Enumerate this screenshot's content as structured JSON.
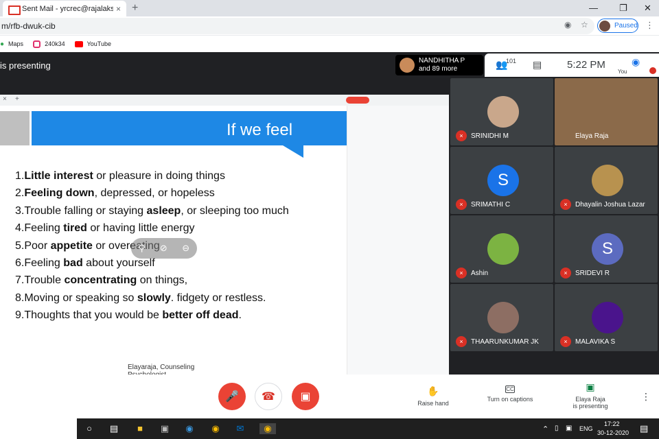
{
  "browser": {
    "tab_title": "Sent Mail - yrcrec@rajalakshmi.e",
    "tab_close": "×",
    "new_tab": "+",
    "url": "m/rfb-dwuk-cib",
    "profile_status": "Paused",
    "bookmarks": [
      {
        "label": "Maps",
        "icon": "maps-icon",
        "color": "#34a853"
      },
      {
        "label": "240k34",
        "icon": "instagram-icon",
        "color": "#e1306c"
      },
      {
        "label": "YouTube",
        "icon": "youtube-icon",
        "color": "#ff0000"
      }
    ]
  },
  "meet": {
    "presenting_text": "is presenting",
    "presenter_chip": {
      "name": "NANDHITHA P",
      "more": "and 89 more"
    },
    "participants_count": "101",
    "clock": "5:22  PM",
    "you_label": "You"
  },
  "slide": {
    "title": "If we feel",
    "items": [
      {
        "num": "1.",
        "bold": "Little interest",
        "rest": " or pleasure in doing things"
      },
      {
        "num": "2.",
        "bold": "Feeling down",
        "rest": ", depressed, or hopeless"
      },
      {
        "num": "3.",
        "pre": "Trouble falling or staying ",
        "bold": "asleep",
        "rest": ", or sleeping too much"
      },
      {
        "num": "4.",
        "pre": "Feeling ",
        "bold": "tired",
        "rest": " or having little energy"
      },
      {
        "num": "5.",
        "pre": "Poor ",
        "bold": "appetite",
        "rest": " or overeating"
      },
      {
        "num": "6.",
        "pre": "Feeling ",
        "bold": "bad",
        "rest": " about yourself"
      },
      {
        "num": "7.",
        "pre": "Trouble ",
        "bold": "concentrating",
        "rest": " on things,"
      },
      {
        "num": "8.",
        "pre": "Moving or speaking so ",
        "bold": "slowly",
        "rest": ". fidgety or restless."
      },
      {
        "num": "9.",
        "pre": "Thoughts that you would be ",
        "bold": "better off dead",
        "rest": "."
      }
    ],
    "footer": "Elayaraja, Counseling Psychologist"
  },
  "participants": [
    {
      "name": "SRINIDHI M",
      "initial": "",
      "avatar_color": "#c9a78b"
    },
    {
      "name": "Elaya Raja",
      "initial": "",
      "avatar_color": "#8b6a4a",
      "video": true
    },
    {
      "name": "SRIMATHI C",
      "initial": "S",
      "avatar_color": "#1a73e8"
    },
    {
      "name": "Dhayalin Joshua Lazar",
      "initial": "",
      "avatar_color": "#b8924f"
    },
    {
      "name": "Ashin",
      "initial": "",
      "avatar_color": "#7cb342"
    },
    {
      "name": "SRIDEVI R",
      "initial": "S",
      "avatar_color": "#5c6bc0"
    },
    {
      "name": "THAARUNKUMAR JK",
      "initial": "",
      "avatar_color": "#8d6e63"
    },
    {
      "name": "MALAVIKA S",
      "initial": "",
      "avatar_color": "#4a148c"
    }
  ],
  "bottom": {
    "raise_hand": "Raise hand",
    "captions": "Turn on captions",
    "captions_icon": "CC",
    "presenting_line1": "Elaya Raja",
    "presenting_line2": "is presenting"
  },
  "taskbar": {
    "lang": "ENG",
    "time": "17:22",
    "date": "30-12-2020"
  }
}
